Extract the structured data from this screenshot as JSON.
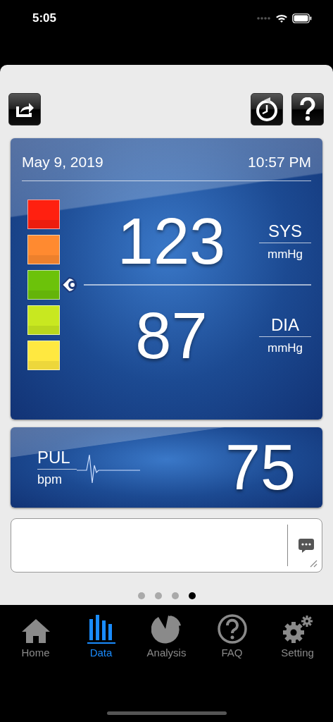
{
  "status_bar": {
    "time": "5:05"
  },
  "reading": {
    "date": "May 9, 2019",
    "time": "10:57 PM",
    "systolic": "123",
    "systolic_label": "SYS",
    "systolic_unit": "mmHg",
    "diastolic": "87",
    "diastolic_label": "DIA",
    "diastolic_unit": "mmHg"
  },
  "levels": [
    {
      "color": "#ff2010",
      "selected": false
    },
    {
      "color": "#ff8a30",
      "selected": false
    },
    {
      "color": "#6cc20a",
      "selected": true
    },
    {
      "color": "#c8e820",
      "selected": false
    },
    {
      "color": "#ffe840",
      "selected": false
    }
  ],
  "pulse": {
    "label": "PUL",
    "unit": "bpm",
    "value": "75"
  },
  "pages": [
    {
      "selected": false
    },
    {
      "selected": false
    },
    {
      "selected": false
    },
    {
      "selected": true
    }
  ],
  "tabs": [
    {
      "kind": "home",
      "label": "Home",
      "selected": false
    },
    {
      "kind": "data",
      "label": "Data",
      "selected": true
    },
    {
      "kind": "analysis",
      "label": "Analysis",
      "selected": false
    },
    {
      "kind": "faq",
      "label": "FAQ",
      "selected": false
    },
    {
      "kind": "setting",
      "label": "Setting",
      "selected": false
    }
  ]
}
